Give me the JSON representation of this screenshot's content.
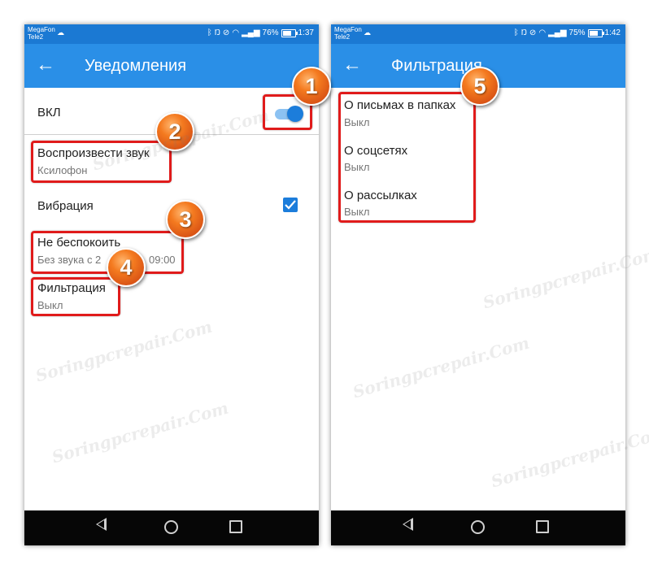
{
  "watermark": "Soringpcrepair.Com",
  "left": {
    "status": {
      "carrier_line1": "MegaFon",
      "carrier_line2": "Tele2",
      "battery": "76%",
      "battery_fraction": 0.76,
      "time": "1:37"
    },
    "app_bar": {
      "title": "Уведомления"
    },
    "rows": {
      "on_label": "ВКЛ",
      "sound_title": "Воспроизвести звук",
      "sound_value": "Ксилофон",
      "vibration_label": "Вибрация",
      "dnd_title": "Не беспокоить",
      "dnd_value": "Без звука с 2",
      "dnd_value_tail": "09:00",
      "filter_title": "Фильтрация",
      "filter_value": "Выкл"
    },
    "toggle_on": true,
    "vibration_checked": true
  },
  "right": {
    "status": {
      "carrier_line1": "MegaFon",
      "carrier_line2": "Tele2",
      "battery": "75%",
      "battery_fraction": 0.75,
      "time": "1:42"
    },
    "app_bar": {
      "title": "Фильтрация"
    },
    "rows": [
      {
        "title": "О письмах в папках",
        "value": "Выкл"
      },
      {
        "title": "О соцсетях",
        "value": "Выкл"
      },
      {
        "title": "О рассылках",
        "value": "Выкл"
      }
    ]
  },
  "badges": [
    "1",
    "2",
    "3",
    "4",
    "5"
  ],
  "colors": {
    "status_bar": "#1b79d3",
    "app_bar": "#2a8fe7",
    "accent": "#1c7ddb",
    "highlight": "#e01b1b",
    "badge": "#f47a1f"
  },
  "icons": {
    "back": "arrow-left-icon",
    "status": [
      "cloud-icon",
      "bluetooth-icon",
      "nfc-icon",
      "mute-icon",
      "wifi-icon",
      "signal-icon",
      "battery-icon"
    ],
    "nav": [
      "nav-back-icon",
      "nav-home-icon",
      "nav-recent-icon"
    ]
  }
}
